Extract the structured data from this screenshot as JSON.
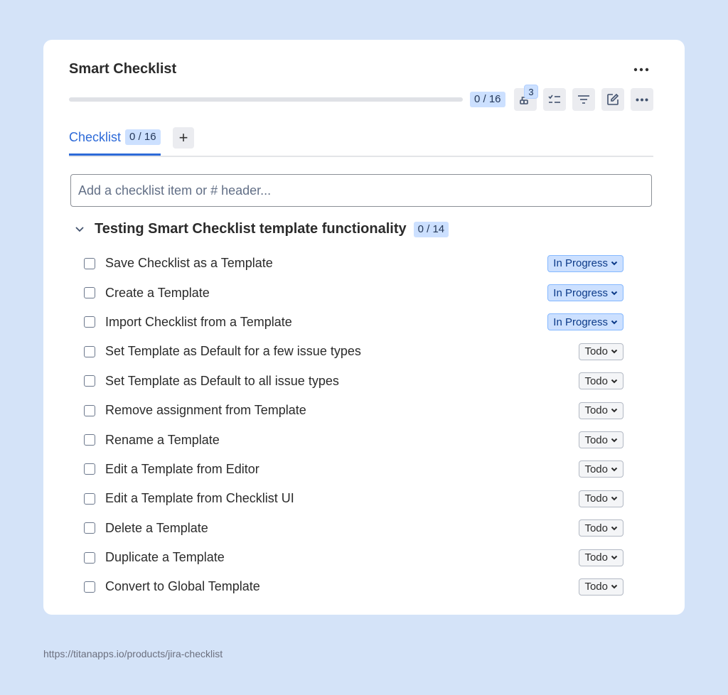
{
  "header": {
    "title": "Smart Checklist",
    "progress_text": "0 / 16",
    "progress_fraction": 0,
    "notification_count": "3"
  },
  "tabs": [
    {
      "label": "Checklist",
      "count": "0 / 16",
      "active": true
    }
  ],
  "add_input": {
    "placeholder": "Add a checklist item or # header..."
  },
  "section": {
    "title": "Testing Smart Checklist template functionality",
    "count": "0 / 14"
  },
  "items": [
    {
      "text": "Save Checklist as a Template",
      "status": "In Progress"
    },
    {
      "text": "Create a Template",
      "status": "In Progress"
    },
    {
      "text": "Import Checklist from a Template",
      "status": "In Progress"
    },
    {
      "text": "Set Template as Default for a few issue types",
      "status": "Todo"
    },
    {
      "text": "Set Template as Default to all issue types",
      "status": "Todo"
    },
    {
      "text": "Remove assignment from Template",
      "status": "Todo"
    },
    {
      "text": "Rename a Template",
      "status": "Todo"
    },
    {
      "text": "Edit a Template from Editor",
      "status": "Todo"
    },
    {
      "text": "Edit a Template from Checklist UI",
      "status": "Todo"
    },
    {
      "text": "Delete a Template",
      "status": "Todo"
    },
    {
      "text": "Duplicate a Template",
      "status": "Todo"
    },
    {
      "text": "Convert to Global Template",
      "status": "Todo"
    }
  ],
  "footer": {
    "url": "https://titanapps.io/products/jira-checklist"
  },
  "colors": {
    "accent": "#2d6ad8",
    "badge_bg": "#cce0ff",
    "in_progress_bg": "#cce0ff",
    "todo_bg": "#f4f5f7",
    "page_bg": "#d4e3f8"
  },
  "icons": {
    "header_more": "more-horizontal-icon",
    "toolbar": [
      "hierarchy-icon",
      "checklist-icon",
      "filter-icon",
      "edit-icon",
      "more-horizontal-icon"
    ],
    "add_tab": "plus-icon",
    "section_toggle": "chevron-down-icon",
    "status_toggle": "chevron-down-icon"
  }
}
